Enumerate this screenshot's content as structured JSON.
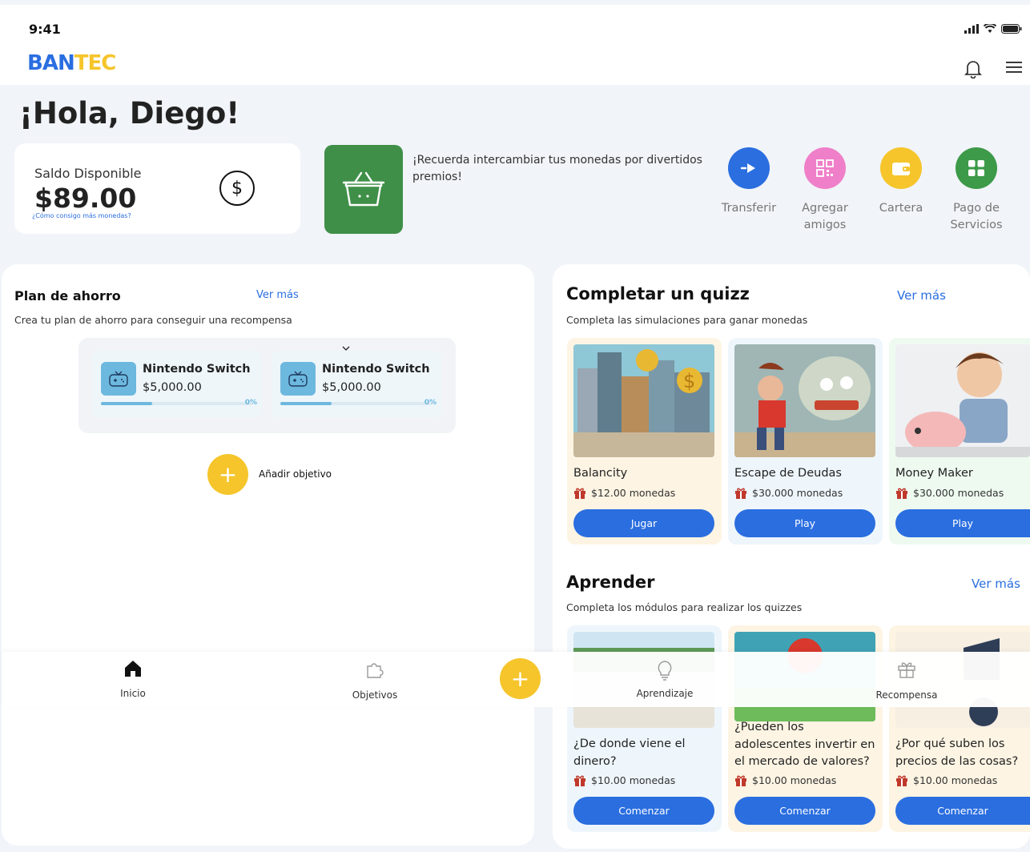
{
  "status": {
    "time": "9:41"
  },
  "brand": {
    "logo_part1": "BAN",
    "logo_part2": "TEC",
    "accent": "#2a6ee0",
    "yellow": "#f5c52b"
  },
  "greeting": "¡Hola, Diego!",
  "balance": {
    "label": "Saldo Disponible",
    "value": "$89.00",
    "link": "¿Cómo consigo más monedas?",
    "icon": "dollar-circle-icon"
  },
  "reminder": {
    "text": "¡Recuerda intercambiar tus monedas por divertidos premios!",
    "icon": "basket-icon"
  },
  "quick_actions": [
    {
      "label": "Transferir",
      "color": "#2a6ee0",
      "icon": "transfer-icon"
    },
    {
      "label": "Agregar amigos",
      "color": "#ef7fc8",
      "icon": "qr-icon"
    },
    {
      "label": "Cartera",
      "color": "#f5c52b",
      "icon": "wallet-icon"
    },
    {
      "label": "Pago de Servicios",
      "color": "#3c9a48",
      "icon": "grid-icon"
    }
  ],
  "savings": {
    "title": "Plan de ahorro",
    "more": "Ver más",
    "subtitle": "Crea tu plan de ahorro para conseguir una recompensa",
    "goals": [
      {
        "name": "Nintendo Switch",
        "price": "$5,000.00",
        "progress": "0%"
      },
      {
        "name": "Nintendo Switch",
        "price": "$5,000.00",
        "progress": "0%"
      }
    ],
    "add_label": "Añadir objetivo"
  },
  "quiz": {
    "title": "Completar un quizz",
    "more": "Ver más",
    "subtitle": "Completa las simulaciones para ganar monedas",
    "cards": [
      {
        "title": "Balancity",
        "reward": "$12.00 monedas",
        "button": "Jugar",
        "bg": "#fdf4e3"
      },
      {
        "title": "Escape de Deudas",
        "reward": "$30.000 monedas",
        "button": "Play",
        "bg": "#eef6fc"
      },
      {
        "title": "Money Maker",
        "reward": "$30.000 monedas",
        "button": "Play",
        "bg": "#eefaf0"
      }
    ]
  },
  "learn": {
    "title": "Aprender",
    "more": "Ver más",
    "subtitle": "Completa los módulos para realizar los quizzes",
    "cards": [
      {
        "title": "¿De donde viene el dinero?",
        "reward": "$10.00 monedas",
        "button": "Comenzar",
        "bg": "#eef6fc"
      },
      {
        "title": "¿Pueden los adolescentes invertir en el mercado de valores?",
        "reward": "$10.00 monedas",
        "button": "Comenzar",
        "bg": "#fdf4e3"
      },
      {
        "title": "¿Por qué suben los precios de las cosas?",
        "reward": "$10.00 monedas",
        "button": "Comenzar",
        "bg": "#fdf4e3"
      }
    ]
  },
  "nav": {
    "items": [
      {
        "label": "Inicio",
        "icon": "home-icon"
      },
      {
        "label": "Objetivos",
        "icon": "puzzle-icon"
      },
      {
        "label": "Aprendizaje",
        "icon": "lightbulb-icon"
      },
      {
        "label": "Recompensa",
        "icon": "gift-icon"
      }
    ]
  }
}
